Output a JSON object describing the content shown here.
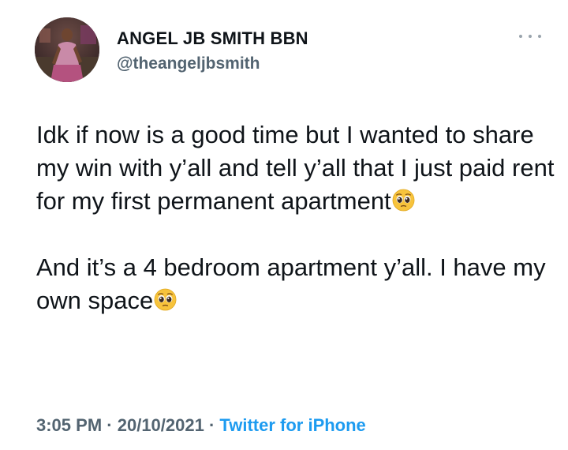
{
  "author": {
    "display_name": "ANGEL JB SMITH BBN",
    "handle": "@theangeljbsmith",
    "avatar_icon": "profile-photo"
  },
  "tweet": {
    "paragraph_1": "Idk if now is a good time but I wanted to share my win with y’all and tell y’all that I just paid rent for my first permanent apartment",
    "paragraph_2": "And it’s a 4 bedroom apartment y’all. I have my own space",
    "emoji": "pleading-face"
  },
  "meta": {
    "time": "3:05 PM",
    "separator": "·",
    "date": "20/10/2021",
    "source": "Twitter for iPhone"
  },
  "colors": {
    "text": "#0f1419",
    "muted": "#536471",
    "link": "#1d9bf0"
  }
}
